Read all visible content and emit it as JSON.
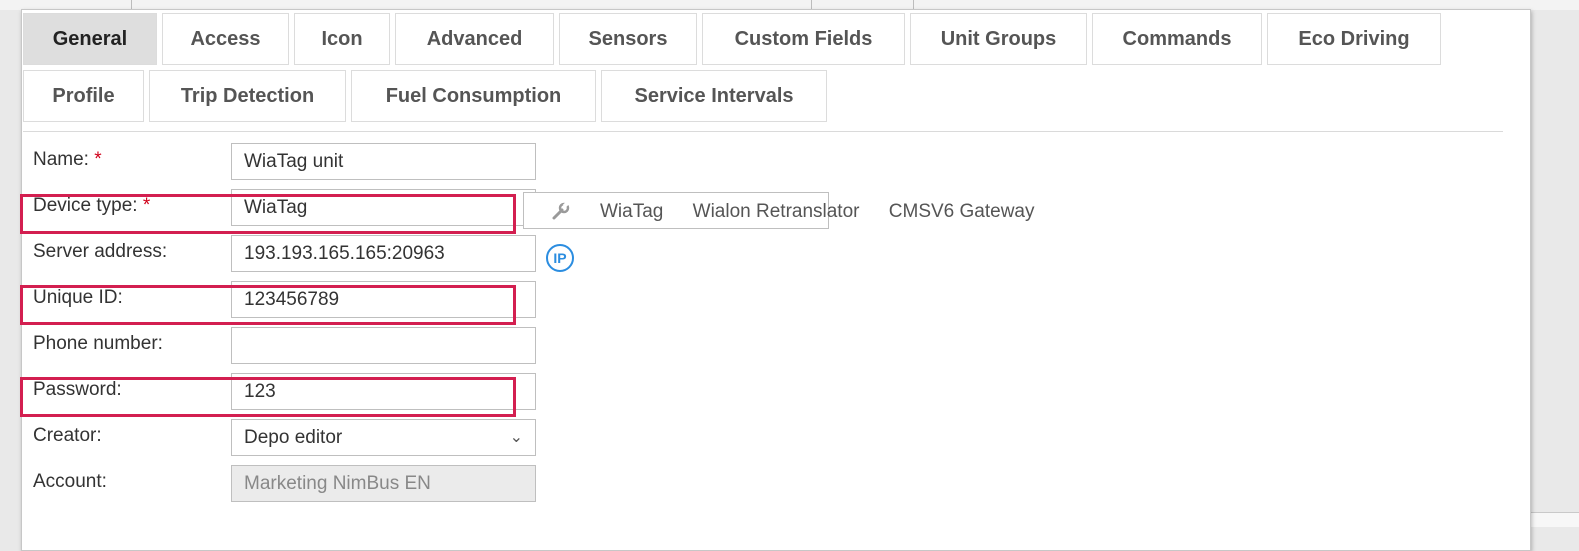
{
  "tabs": {
    "row1": [
      "General",
      "Access",
      "Icon",
      "Advanced",
      "Sensors",
      "Custom Fields",
      "Unit Groups",
      "Commands",
      "Eco Driving"
    ],
    "row2": [
      "Profile",
      "Trip Detection",
      "Fuel Consumption",
      "Service Intervals"
    ]
  },
  "form": {
    "name_label": "Name:",
    "name_value": "WiaTag unit",
    "device_type_label": "Device type:",
    "device_type_value": "WiaTag",
    "server_address_label": "Server address:",
    "server_address_value": "193.193.165.165:20963",
    "unique_id_label": "Unique ID:",
    "unique_id_value": "123456789",
    "phone_label": "Phone number:",
    "phone_value": "",
    "phone2_value": "",
    "password_label": "Password:",
    "password_value": "123",
    "creator_label": "Creator:",
    "creator_value": "Depo editor",
    "account_label": "Account:",
    "account_value": "Marketing NimBus EN",
    "required_mark": "*"
  },
  "device_links": [
    "WiaTag",
    "Wialon Retranslator",
    "CMSV6 Gateway"
  ],
  "ip_icon_text": "IP",
  "colors": {
    "highlight": "#d31f50",
    "accent": "#2b8de0",
    "required": "#d0021b"
  }
}
